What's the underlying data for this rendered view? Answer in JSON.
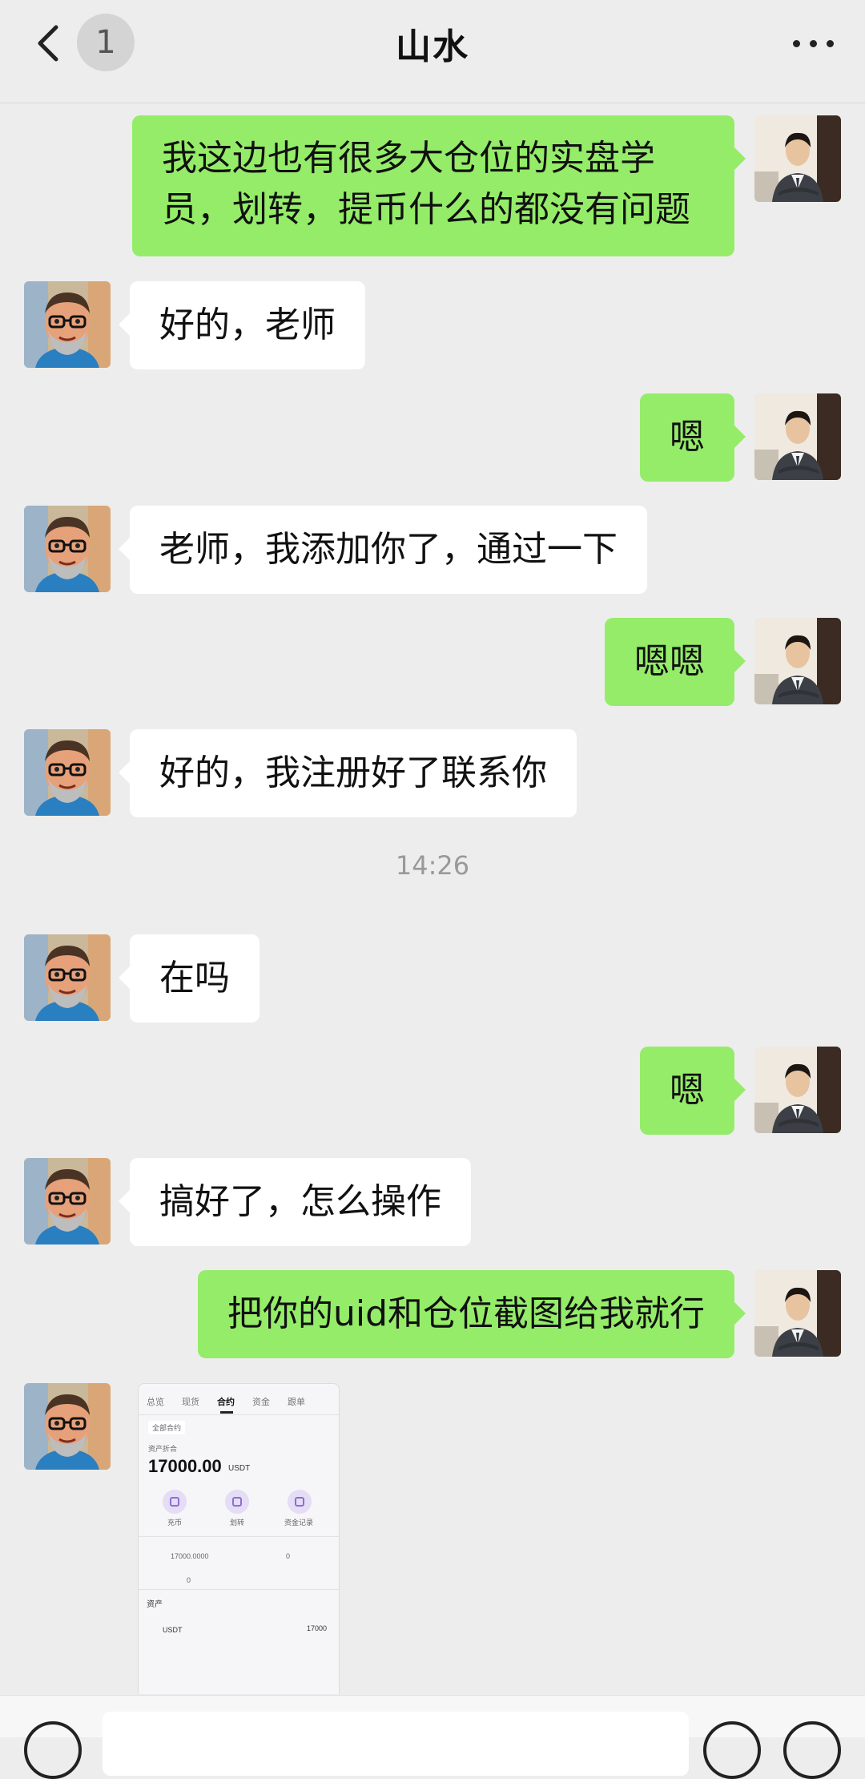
{
  "header": {
    "title": "山水",
    "unread_count": "1"
  },
  "messages": [
    {
      "side": "right",
      "text": "我这边也有很多大仓位的实盘学员，划转，提币什么的都没有问题"
    },
    {
      "side": "left",
      "text": "好的，老师"
    },
    {
      "side": "right",
      "text": "嗯"
    },
    {
      "side": "left",
      "text": "老师，我添加你了，通过一下"
    },
    {
      "side": "right",
      "text": "嗯嗯"
    },
    {
      "side": "left",
      "text": "好的，我注册好了联系你"
    },
    {
      "type": "time",
      "text": "14:26"
    },
    {
      "side": "left",
      "text": "在吗"
    },
    {
      "side": "right",
      "text": "嗯"
    },
    {
      "side": "left",
      "text": "搞好了，怎么操作"
    },
    {
      "side": "right",
      "text": "把你的uid和仓位截图给我就行"
    },
    {
      "side": "left",
      "type": "image"
    }
  ],
  "screenshot": {
    "tabs": [
      "总览",
      "现货",
      "合约",
      "资金",
      "跟单"
    ],
    "active_tab": "合约",
    "account_label": "全部合约",
    "asset_label": "资产折合",
    "balance": "17000.00",
    "unit": "USDT",
    "actions": [
      "充币",
      "划转",
      "资金记录"
    ],
    "stat_left_value": "17000.0000",
    "stat_right_value": "0",
    "stat_bottom_value": "0",
    "section_label": "资产",
    "coin": "USDT",
    "coin_value": "17000"
  },
  "input": {
    "placeholder": ""
  },
  "colors": {
    "self_bubble": "#95ec69",
    "other_bubble": "#ffffff",
    "background": "#ededed"
  }
}
